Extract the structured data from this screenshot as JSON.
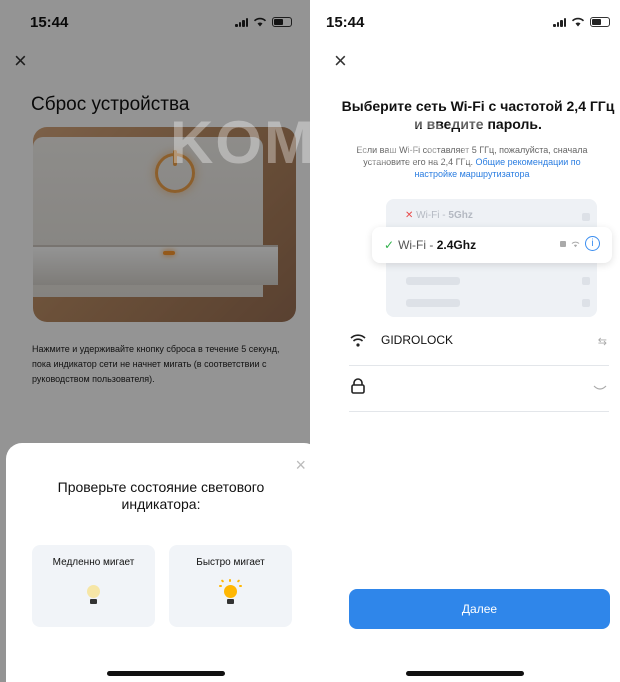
{
  "left_screen": {
    "status": {
      "time": "15:44"
    },
    "close_glyph": "×",
    "title": "Сброс устройства",
    "description": "Нажмите и удерживайте кнопку сброса в течение 5 секунд, пока индикатор сети не начнет мигать (в соответствии с руководством пользователя).",
    "sheet": {
      "close_glyph": "×",
      "title": "Проверьте состояние светового индикатора:",
      "options": [
        {
          "label": "Медленно мигает",
          "icon": "dim-bulb-icon"
        },
        {
          "label": "Быстро мигает",
          "icon": "bright-bulb-icon"
        }
      ]
    }
  },
  "right_screen": {
    "status": {
      "time": "15:44"
    },
    "close_glyph": "×",
    "title": "Выберите сеть Wi-Fi с частотой 2,4 ГГц и введите пароль.",
    "note": "Если ваш Wi-Fi составляет 5 ГГц, пожалуйста, сначала установите его на 2,4 ГГц.",
    "note_link": "Общие рекомендации по настройке маршрутизатора",
    "illustration": {
      "bad_prefix": "Wi-Fi - ",
      "bad_band": "5Ghz",
      "good_prefix": "Wi-Fi - ",
      "good_band": "2.4Ghz",
      "info_glyph": "i"
    },
    "ssid_field": {
      "value": "GIDROLOCK",
      "right_icon": "swap-icon"
    },
    "password_field": {
      "value": "",
      "right_icon": "eye-closed-icon"
    },
    "next_label": "Далее"
  },
  "watermark": "KOMFORT",
  "colors": {
    "accent": "#2f86ea",
    "ok": "#31b24c",
    "error": "#e84a4a",
    "led": "#ff9a2e"
  }
}
